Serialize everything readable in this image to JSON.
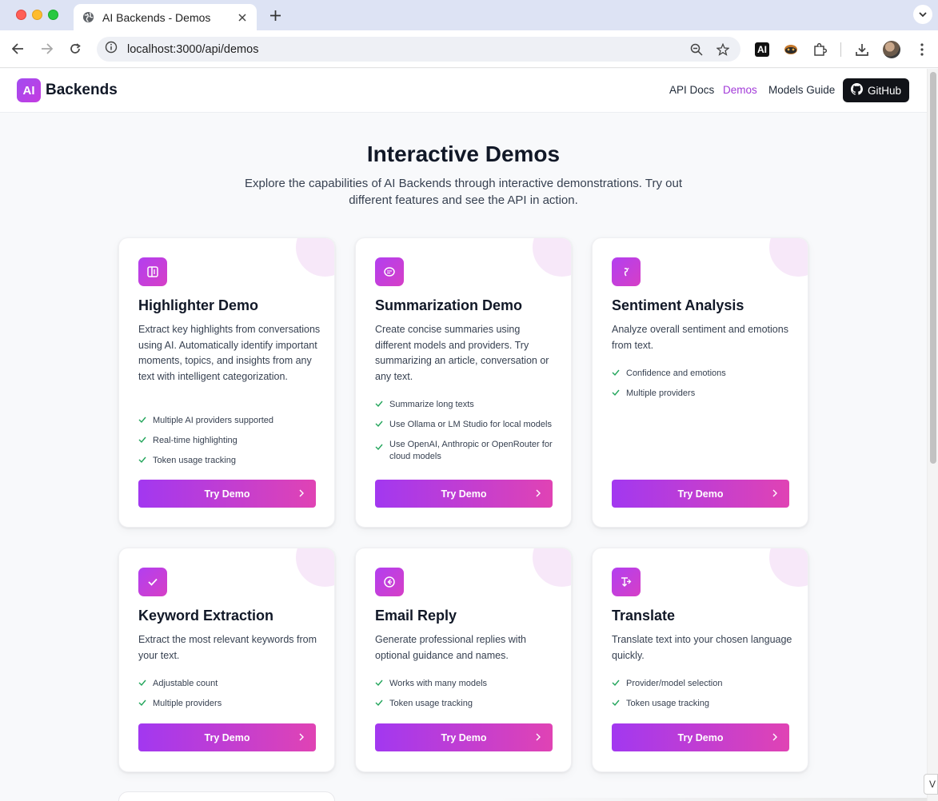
{
  "browser": {
    "tab_title": "AI Backends - Demos",
    "url": "localhost:3000/api/demos",
    "ext_ai_label": "AI"
  },
  "header": {
    "logo_badge": "AI",
    "logo_text": "Backends",
    "nav": {
      "api_docs": "API Docs",
      "demos": "Demos",
      "models_guide": "Models Guide",
      "github": "GitHub"
    },
    "active_color": "#a23ad8"
  },
  "hero": {
    "title": "Interactive Demos",
    "subtitle": "Explore the capabilities of AI Backends through interactive demonstrations. Try out different features and see the API in action."
  },
  "cards": [
    {
      "title": "Highlighter Demo",
      "icon": "highlighter-icon",
      "description": "Extract key highlights from conversations using AI. Automatically identify important moments, topics, and insights from any text with intelligent categorization.",
      "features": [
        "Multiple AI providers supported",
        "Real-time highlighting",
        "Token usage tracking"
      ],
      "button": "Try Demo"
    },
    {
      "title": "Summarization Demo",
      "icon": "summarize-icon",
      "description": "Create concise summaries using different models and providers. Try summarizing an article, conversation or any text.",
      "features": [
        "Summarize long texts",
        "Use Ollama or LM Studio for local models",
        "Use OpenAI, Anthropic or OpenRouter for cloud models"
      ],
      "button": "Try Demo"
    },
    {
      "title": "Sentiment Analysis",
      "icon": "sentiment-icon",
      "description": "Analyze overall sentiment and emotions from text.",
      "features": [
        "Confidence and emotions",
        "Multiple providers"
      ],
      "button": "Try Demo"
    },
    {
      "title": "Keyword Extraction",
      "icon": "checkmark-icon",
      "description": "Extract the most relevant keywords from your text.",
      "features": [
        "Adjustable count",
        "Multiple providers"
      ],
      "button": "Try Demo"
    },
    {
      "title": "Email Reply",
      "icon": "reply-icon",
      "description": "Generate professional replies with optional guidance and names.",
      "features": [
        "Works with many models",
        "Token usage tracking"
      ],
      "button": "Try Demo"
    },
    {
      "title": "Translate",
      "icon": "translate-icon",
      "description": "Translate text into your chosen language quickly.",
      "features": [
        "Provider/model selection",
        "Token usage tracking"
      ],
      "button": "Try Demo"
    }
  ],
  "colors": {
    "accent_start": "#a238f0",
    "accent_end": "#e043b4",
    "check_green": "#22a55b"
  },
  "corner_popup_text": "V"
}
